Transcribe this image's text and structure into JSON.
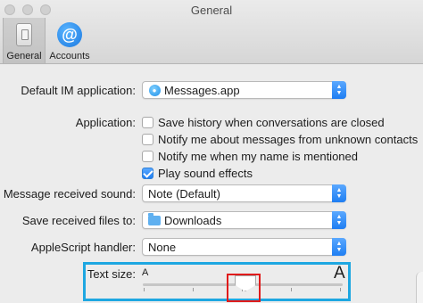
{
  "window": {
    "title": "General"
  },
  "toolbar": {
    "items": [
      {
        "label": "General",
        "icon": "switch-icon",
        "selected": true
      },
      {
        "label": "Accounts",
        "icon": "at-icon",
        "selected": false
      }
    ]
  },
  "settings": {
    "default_im": {
      "label": "Default IM application:",
      "value": "Messages.app",
      "icon": "messages-icon"
    },
    "application": {
      "label": "Application:",
      "options": [
        {
          "label": "Save history when conversations are closed",
          "checked": false
        },
        {
          "label": "Notify me about messages from unknown contacts",
          "checked": false
        },
        {
          "label": "Notify me when my name is mentioned",
          "checked": false
        },
        {
          "label": "Play sound effects",
          "checked": true
        }
      ]
    },
    "message_sound": {
      "label": "Message received sound:",
      "value": "Note (Default)"
    },
    "save_files": {
      "label": "Save received files to:",
      "value": "Downloads",
      "icon": "folder-icon"
    },
    "applescript": {
      "label": "AppleScript handler:",
      "value": "None"
    },
    "text_size": {
      "label": "Text size:",
      "small_label": "A",
      "large_label": "A",
      "level": 0.5
    }
  },
  "colors": {
    "accent": "#1f7ef2",
    "highlight_box": "#1ea7e1",
    "red_box": "#e01b1b"
  }
}
